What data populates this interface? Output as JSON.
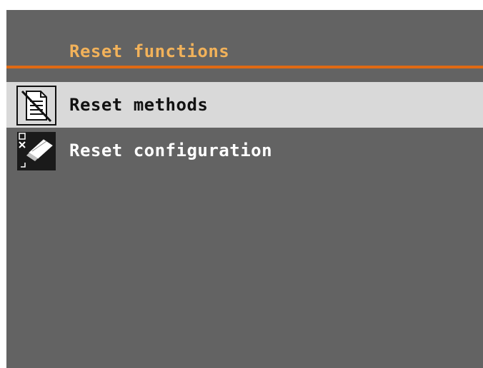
{
  "header": {
    "title": "Reset functions"
  },
  "menu": {
    "items": [
      {
        "label": "Reset methods",
        "icon": "document-strike-icon",
        "selected": true
      },
      {
        "label": "Reset configuration",
        "icon": "eraser-icon",
        "selected": false
      }
    ]
  },
  "colors": {
    "background": "#636363",
    "title": "#f2b25a",
    "accent_line": "#e06a14",
    "selected_row": "#d9d9d9"
  }
}
